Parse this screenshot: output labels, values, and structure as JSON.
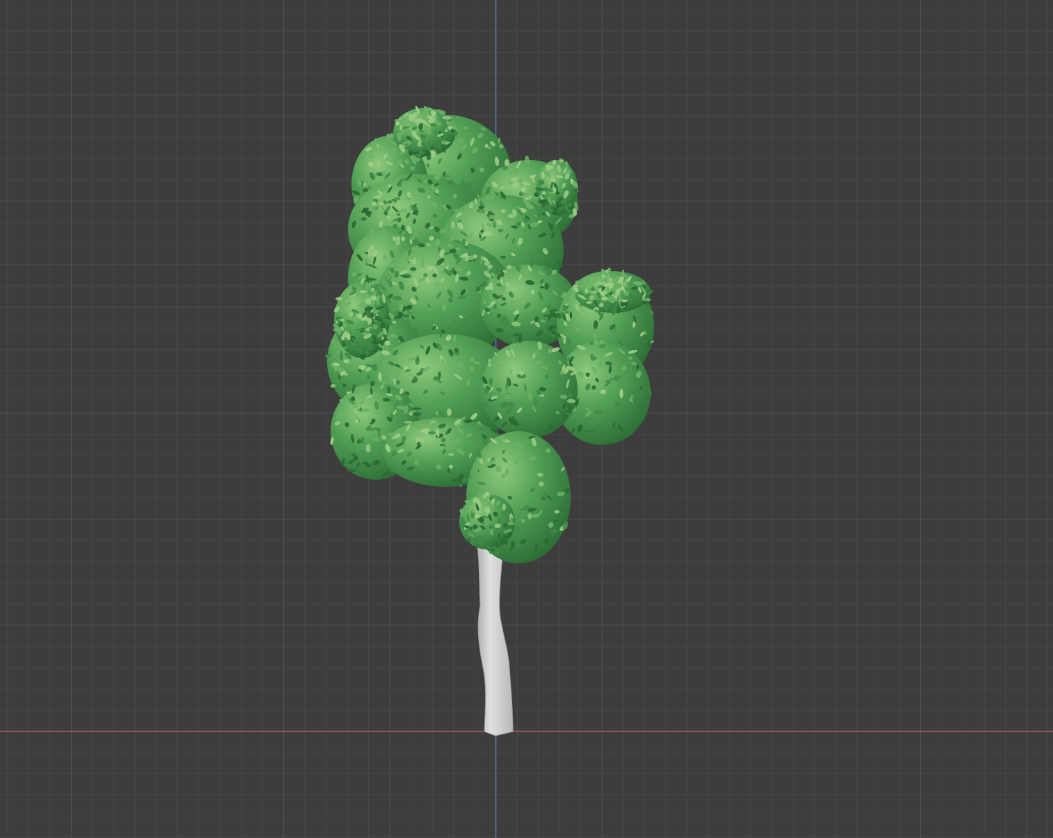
{
  "viewport": {
    "background": "#3d3d3d",
    "grid_minor_color": "#474747",
    "grid_major_color": "#505050",
    "axis_x_color": "#b05a5e",
    "axis_z_color": "#5a83b6"
  },
  "scene": {
    "object": "tree",
    "trunk_color": "#d4d4d4",
    "foliage_colors": {
      "dark": "#2a6a33",
      "mid": "#3f8a48",
      "light": "#6cb066",
      "highlight": "#9ccc86"
    }
  }
}
